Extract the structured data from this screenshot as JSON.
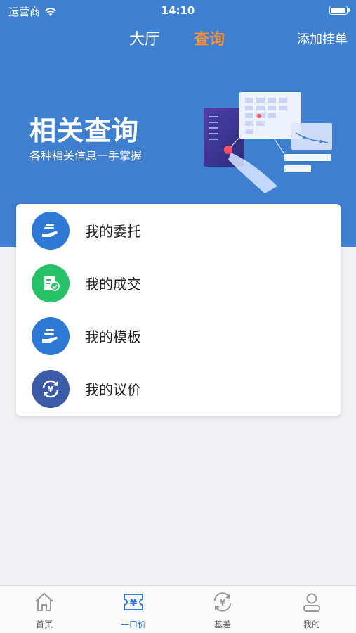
{
  "status_bar": {
    "carrier": "运营商",
    "time": "14:10"
  },
  "nav": {
    "tab_hall": "大厅",
    "tab_query": "查询",
    "action": "添加挂单"
  },
  "banner": {
    "title": "相关查询",
    "subtitle": "各种相关信息一手掌握"
  },
  "menu": {
    "items": [
      {
        "label": "我的委托",
        "icon": "hand-money-icon",
        "color": "#2f79d6"
      },
      {
        "label": "我的成交",
        "icon": "document-check-icon",
        "color": "#27c267"
      },
      {
        "label": "我的模板",
        "icon": "hand-money-icon",
        "color": "#2f79d6"
      },
      {
        "label": "我的议价",
        "icon": "yuan-cycle-icon",
        "color": "#3b5ba8"
      }
    ]
  },
  "tabbar": {
    "items": [
      {
        "label": "首页",
        "icon": "home-icon"
      },
      {
        "label": "一口价",
        "icon": "yuan-ticket-icon",
        "active": true
      },
      {
        "label": "基差",
        "icon": "yuan-refresh-icon"
      },
      {
        "label": "我的",
        "icon": "user-icon"
      }
    ]
  },
  "colors": {
    "primary": "#3f7fd0",
    "accent": "#f4913a",
    "active_tab": "#2f79d6"
  }
}
